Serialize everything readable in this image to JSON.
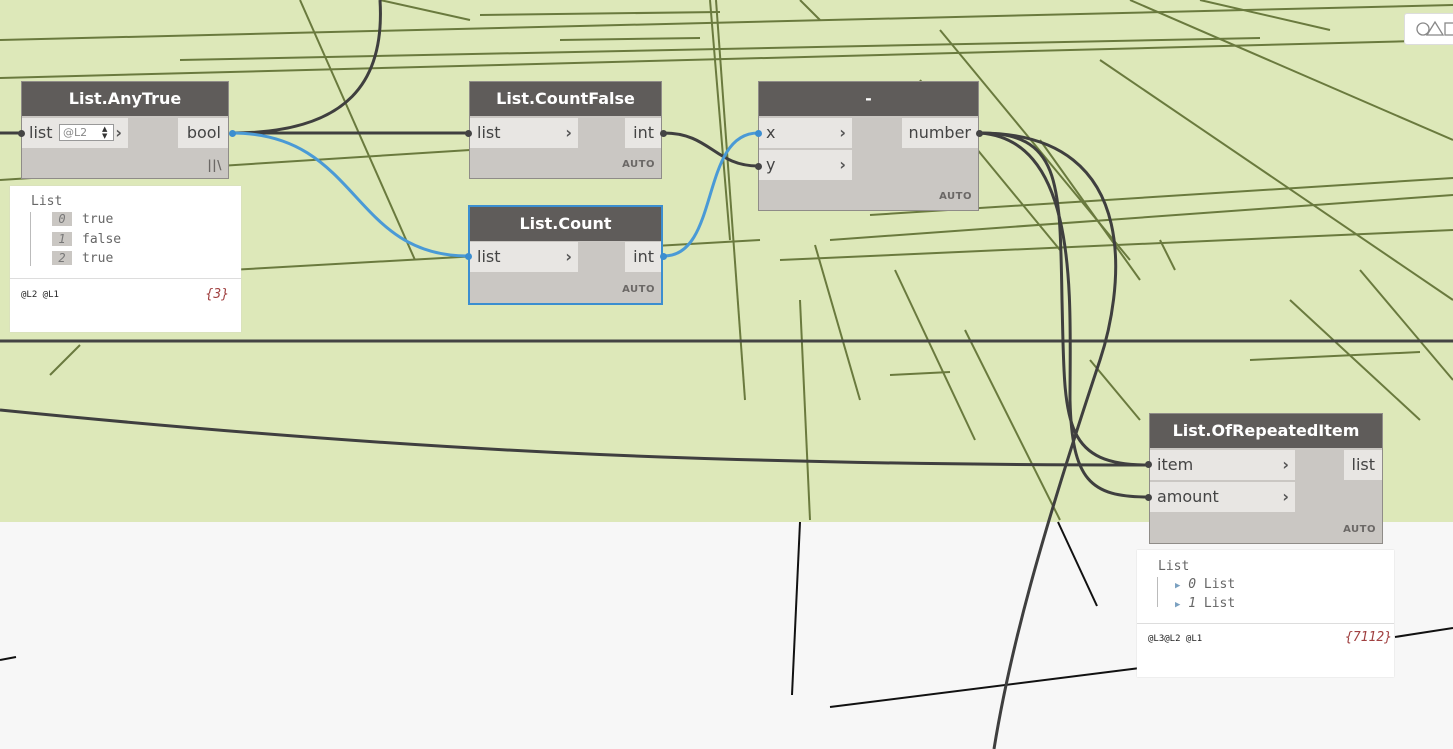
{
  "nodes": {
    "any_true": {
      "title": "List.AnyTrue",
      "input": "list",
      "lacing_input": "@L2",
      "output": "bool",
      "lacing": "||\\"
    },
    "count_false": {
      "title": "List.CountFalse",
      "input": "list",
      "output": "int",
      "lacing": "AUTO"
    },
    "count": {
      "title": "List.Count",
      "input": "list",
      "output": "int",
      "lacing": "AUTO"
    },
    "minus": {
      "title": "-",
      "input_x": "x",
      "input_y": "y",
      "output": "number",
      "lacing": "AUTO"
    },
    "repeated": {
      "title": "List.OfRepeatedItem",
      "input_item": "item",
      "input_amount": "amount",
      "output": "list",
      "lacing": "AUTO"
    }
  },
  "preview_any_true": {
    "header": "List",
    "items": [
      {
        "index": "0",
        "value": "true"
      },
      {
        "index": "1",
        "value": "false"
      },
      {
        "index": "2",
        "value": "true"
      }
    ],
    "levels": "@L2 @L1",
    "count": "{3}"
  },
  "preview_repeated": {
    "header": "List",
    "items": [
      {
        "index": "0",
        "value": "List"
      },
      {
        "index": "1",
        "value": "List"
      }
    ],
    "levels": "@L3@L2 @L1",
    "count": "{7112}"
  },
  "colors": {
    "canvas_green": "#dde8b9",
    "canvas_gray": "#f7f7f7",
    "wire": "#3f3f3f",
    "wire_selected": "#4a9ad6",
    "geometry_lines": "#6a7a3e"
  }
}
